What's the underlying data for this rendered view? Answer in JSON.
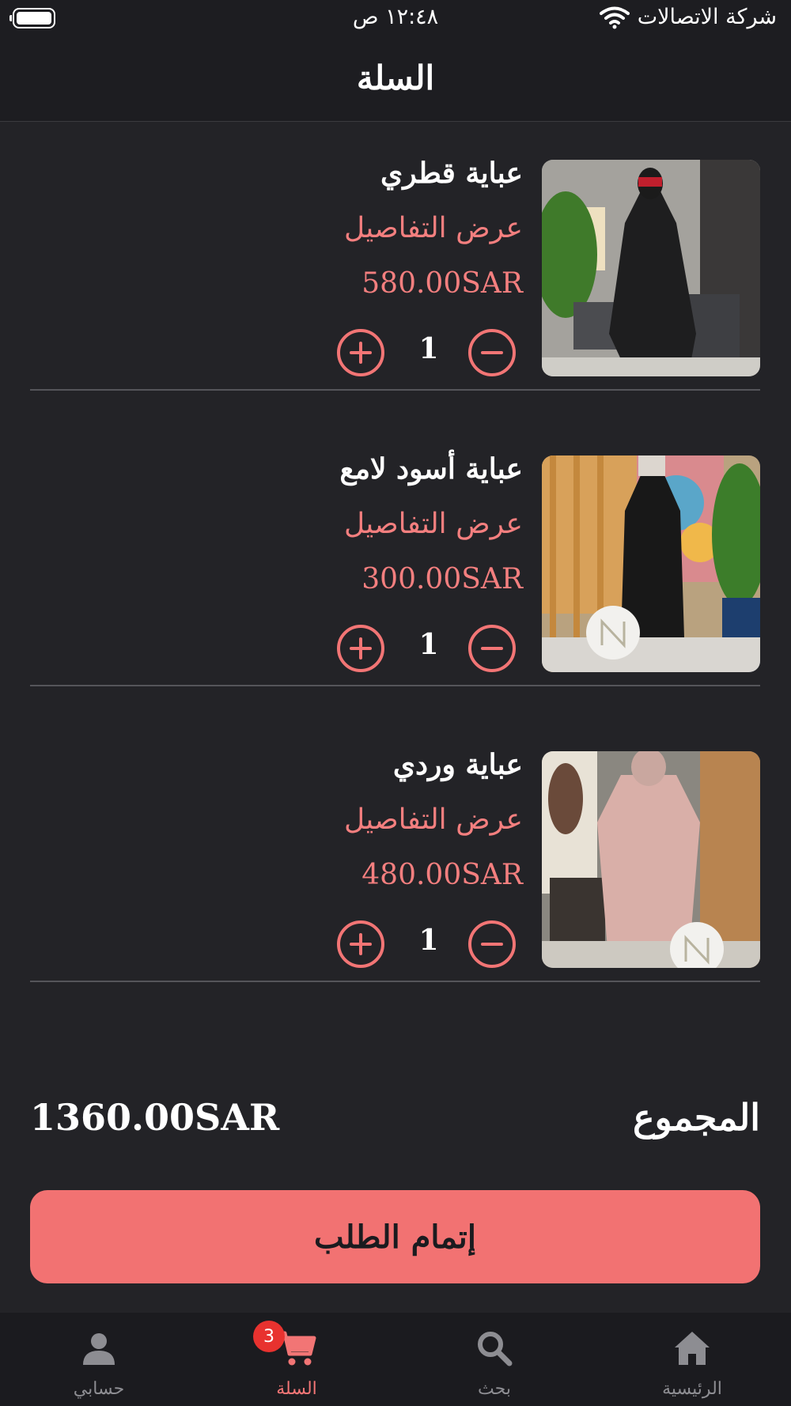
{
  "status_bar": {
    "carrier": "شركة الاتصالات",
    "time": "١٢:٤٨ ص"
  },
  "header": {
    "title": "السلة"
  },
  "cart": {
    "details_label": "عرض التفاصيل",
    "items": [
      {
        "name": "عباية قطري",
        "price": "580.00SAR",
        "quantity": "1"
      },
      {
        "name": "عباية أسود لامع",
        "price": "300.00SAR",
        "quantity": "1"
      },
      {
        "name": "عباية وردي",
        "price": "480.00SAR",
        "quantity": "1"
      }
    ]
  },
  "summary": {
    "total_label": "المجموع",
    "total_value": "1360.00SAR"
  },
  "checkout": {
    "label": "إتمام الطلب"
  },
  "tab_bar": {
    "tabs": [
      {
        "label": "حسابي",
        "icon": "person-icon"
      },
      {
        "label": "السلة",
        "icon": "cart-icon"
      },
      {
        "label": "بحث",
        "icon": "search-icon"
      },
      {
        "label": "الرئيسية",
        "icon": "home-icon"
      }
    ],
    "cart_badge": "3"
  },
  "colors": {
    "accent": "#f27575",
    "background": "#232327",
    "bar": "#1b1b1f"
  }
}
